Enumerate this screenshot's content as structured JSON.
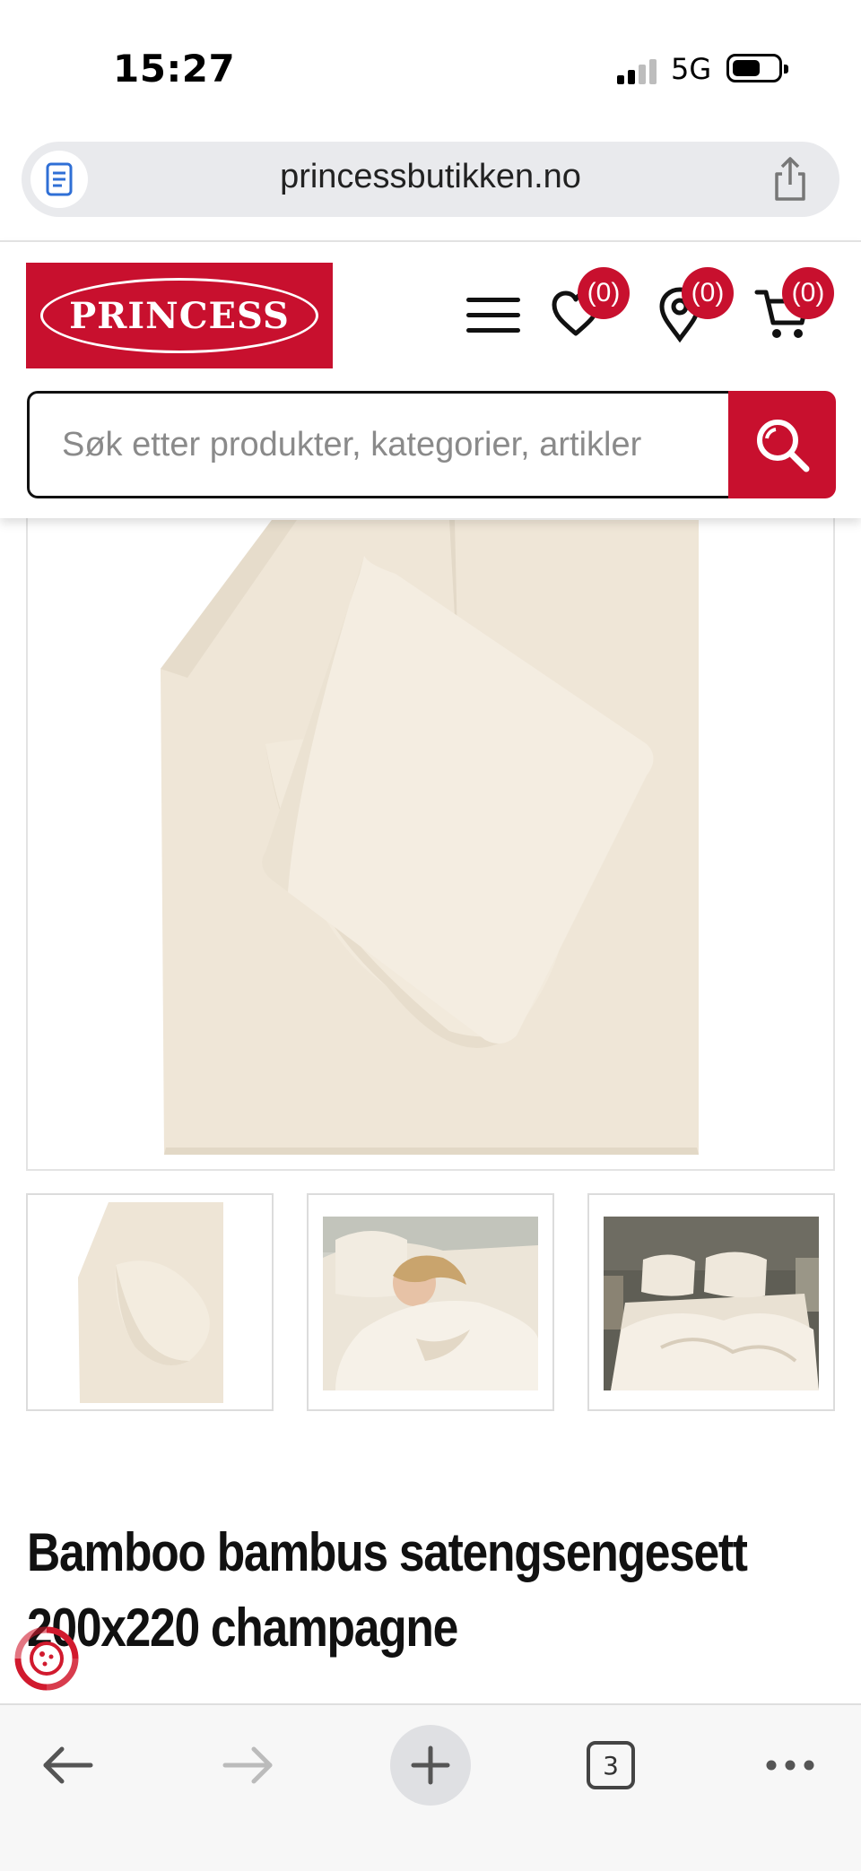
{
  "status_bar": {
    "time": "15:27",
    "network": "5G",
    "battery_level": 0.6
  },
  "browser": {
    "url": "princessbutikken.no",
    "reader_icon": "reader-mode-icon",
    "share_icon": "share-icon",
    "tab_count": "3"
  },
  "header": {
    "logo_text": "PRINCESS",
    "brand_color": "#c8102e",
    "wishlist_count": "(0)",
    "stores_count": "(0)",
    "cart_count": "(0)",
    "search_placeholder": "Søk etter produkter, kategorier, artikler"
  },
  "product": {
    "title": "Bamboo bambus satengsengesett 200x220 champagne",
    "image_color": "#efe6d8",
    "thumbnails": [
      "duvet-and-pillow-thumbnail",
      "woman-sleeping-thumbnail",
      "bed-made-thumbnail"
    ]
  }
}
